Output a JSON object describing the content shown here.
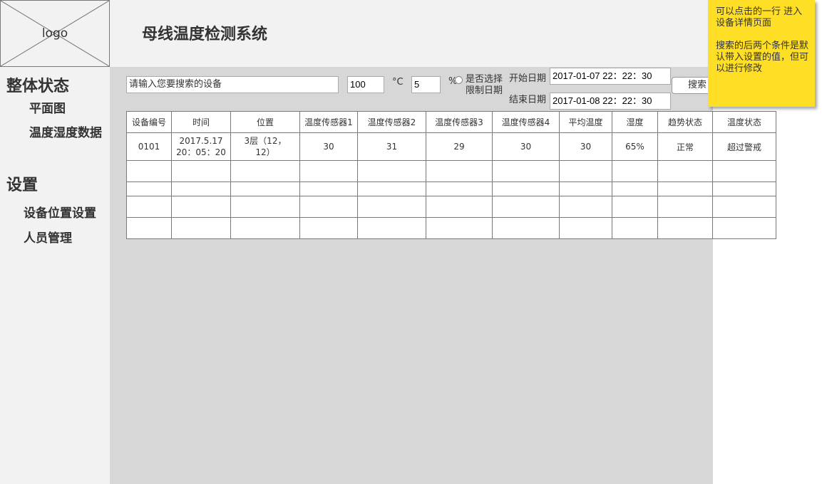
{
  "header": {
    "logo_text": "logo",
    "app_title": "母线温度检测系统"
  },
  "sidebar": {
    "groups": [
      {
        "label": "整体状态",
        "items": [
          {
            "label": "平面图"
          },
          {
            "label": "温度湿度数据"
          }
        ]
      },
      {
        "label": "设置",
        "items": [
          {
            "label": "设备位置设置"
          },
          {
            "label": "人员管理"
          }
        ]
      }
    ]
  },
  "filters": {
    "search_placeholder": "请输入您要搜索的设备",
    "temp_value": "100",
    "temp_unit": "°C",
    "humidity_value": "5",
    "humidity_unit": "%",
    "date_limit_label_line1": "是否选择",
    "date_limit_label_line2": "限制日期",
    "start_date_label": "开始日期",
    "start_date_value": "2017-01-07 22：22：30",
    "end_date_label": "结束日期",
    "end_date_value": "2017-01-08 22：22：30",
    "search_button": "搜索"
  },
  "table": {
    "headers": [
      "设备编号",
      "时间",
      "位置",
      "温度传感器1",
      "温度传感器2",
      "温度传感器3",
      "温度传感器4",
      "平均温度",
      "湿度",
      "趋势状态",
      "温度状态"
    ],
    "rows": [
      {
        "device_id": "0101",
        "time_line1": "2017.5.17",
        "time_line2": "20：05：20",
        "location_line1": "3层（12，",
        "location_line2": "12）",
        "sensor1": "30",
        "sensor2": "31",
        "sensor3": "29",
        "sensor4": "30",
        "avg_temp": "30",
        "humidity": "65%",
        "trend_status": "正常",
        "temp_status": "超过警戒"
      }
    ]
  },
  "note": {
    "line1": "可以点击的一行 进入设备详情页面",
    "line2": "搜索的后两个条件是默认带入设置的值，但可以进行修改"
  },
  "colors": {
    "status_ok": "#00bf00",
    "status_alarm": "#e60000",
    "humidity_value": "#00d5a0",
    "note_background": "#ffdf25"
  }
}
